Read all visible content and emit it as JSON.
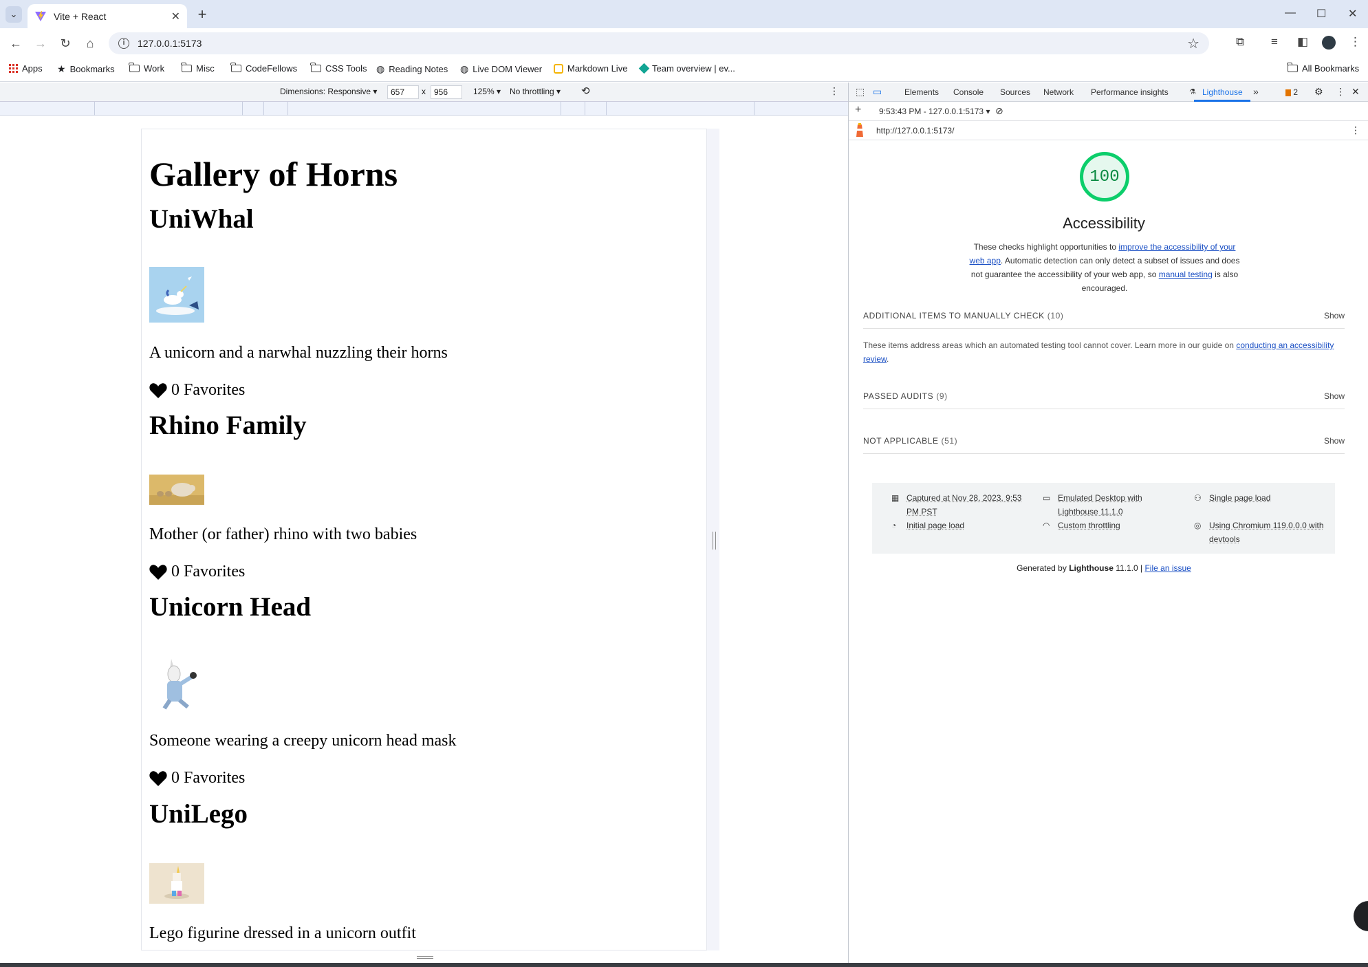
{
  "browser": {
    "tab": {
      "title": "Vite + React"
    },
    "address": {
      "url": "127.0.0.1:5173"
    },
    "bookmarks": [
      {
        "label": "Apps",
        "icon": "apps-icon"
      },
      {
        "label": "Bookmarks",
        "icon": "star-icon"
      },
      {
        "label": "Work",
        "icon": "folder-icon"
      },
      {
        "label": "Misc",
        "icon": "folder-icon"
      },
      {
        "label": "CodeFellows",
        "icon": "folder-icon"
      },
      {
        "label": "CSS Tools",
        "icon": "folder-icon"
      },
      {
        "label": "Reading Notes",
        "icon": "globe-icon"
      },
      {
        "label": "Live DOM Viewer",
        "icon": "globe-icon"
      },
      {
        "label": "Markdown Live",
        "icon": "markdown-icon"
      },
      {
        "label": "Team overview | ev...",
        "icon": "diamond-icon"
      }
    ],
    "all_bookmarks": "All Bookmarks"
  },
  "emulation": {
    "dimensions": "Dimensions: Responsive",
    "width": "657",
    "times": "x",
    "height": "956",
    "zoom": "125%",
    "throttling": "No throttling"
  },
  "gallery": {
    "title": "Gallery of Horns",
    "horns": [
      {
        "title": "UniWhal",
        "description": "A unicorn and a narwhal nuzzling their horns",
        "favorites": "0 Favorites"
      },
      {
        "title": "Rhino Family",
        "description": "Mother (or father) rhino with two babies",
        "favorites": "0 Favorites"
      },
      {
        "title": "Unicorn Head",
        "description": "Someone wearing a creepy unicorn head mask",
        "favorites": "0 Favorites"
      },
      {
        "title": "UniLego",
        "description": "Lego figurine dressed in a unicorn outfit"
      }
    ]
  },
  "devtools": {
    "tabs": [
      "Elements",
      "Console",
      "Sources",
      "Network",
      "Performance insights",
      "Lighthouse"
    ],
    "active_tab": "Lighthouse",
    "issues_count": "2",
    "report_time": "9:53:43 PM - 127.0.0.1:5173",
    "report_url": "http://127.0.0.1:5173/",
    "score": "100",
    "category": "Accessibility",
    "desc": {
      "pre": "These checks highlight opportunities to ",
      "link1": "improve the accessibility of your web app",
      "mid": ". Automatic detection can only detect a subset of issues and does not guarantee the accessibility of your web app, so ",
      "link2": "manual testing",
      "post": " is also encouraged."
    },
    "groups": [
      {
        "title": "ADDITIONAL ITEMS TO MANUALLY CHECK",
        "count": "(10)",
        "show": "Show"
      },
      {
        "title": "PASSED AUDITS",
        "count": "(9)",
        "show": "Show"
      },
      {
        "title": "NOT APPLICABLE",
        "count": "(51)",
        "show": "Show"
      }
    ],
    "manual_desc": {
      "pre": "These items address areas which an automated testing tool cannot cover. Learn more in our guide on ",
      "link": "conducting an accessibility review",
      "post": "."
    },
    "footer": {
      "captured": "Captured at Nov 28, 2023, 9:53 PM PST",
      "initial": "Initial page load",
      "emulated": "Emulated Desktop with Lighthouse 11.1.0",
      "throttling": "Custom throttling",
      "single": "Single page load",
      "chromium": "Using Chromium 119.0.0.0 with devtools"
    },
    "generated": {
      "pre": "Generated by ",
      "brand": "Lighthouse",
      "version": " 11.1.0 | ",
      "link": "File an issue"
    }
  },
  "colors": {
    "accent": "#1a73e8",
    "score_green": "#0cce6b",
    "link": "#1a4fc4"
  }
}
